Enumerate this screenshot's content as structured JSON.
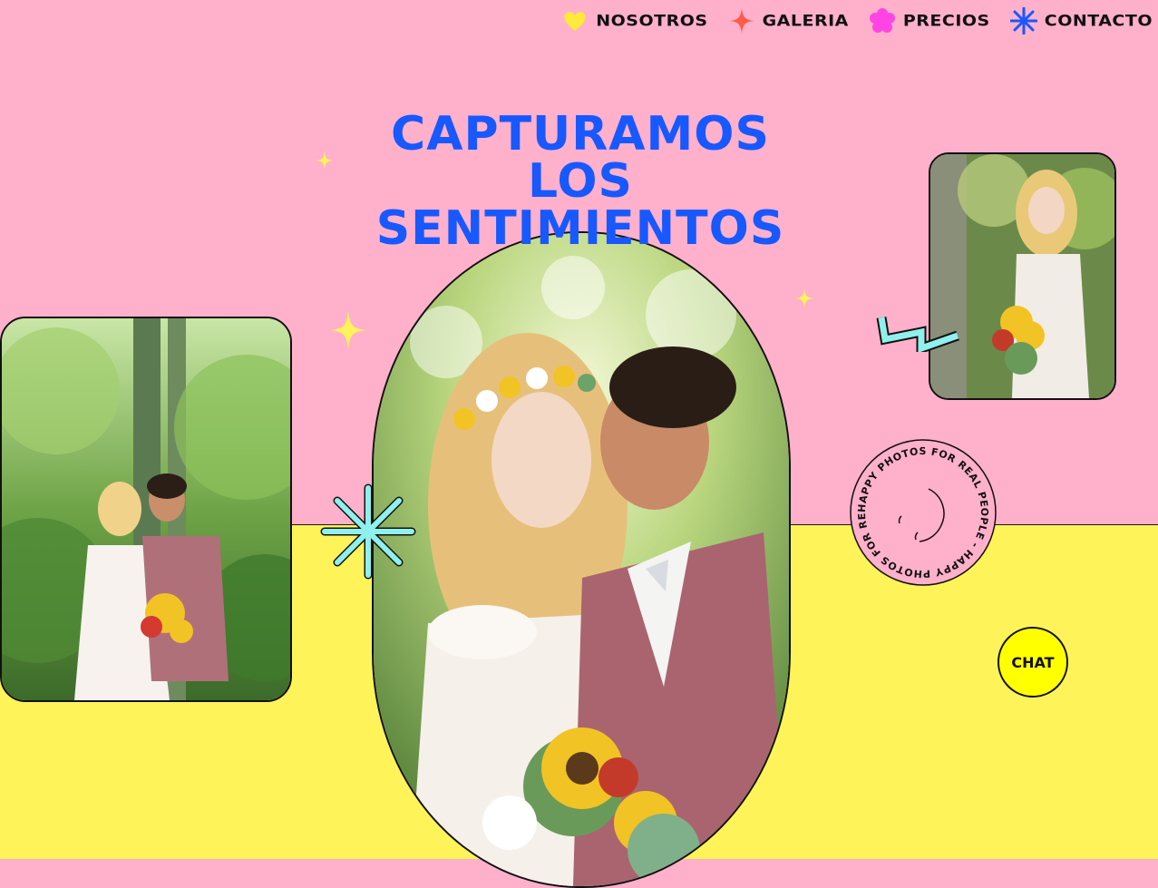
{
  "nav": {
    "items": [
      {
        "label": "NOSOTROS",
        "icon": "heart-icon",
        "color": "#ffe93a"
      },
      {
        "label": "GALERIA",
        "icon": "four-point-star-icon",
        "color": "#ff5a4a"
      },
      {
        "label": "PRECIOS",
        "icon": "flower-icon",
        "color": "#ff44e6"
      },
      {
        "label": "CONTACTO",
        "icon": "asterisk-icon",
        "color": "#1758ff"
      }
    ]
  },
  "hero": {
    "title_lines": [
      "CAPTURAMOS",
      "LOS",
      "SENTIMIENTOS"
    ]
  },
  "badge": {
    "text": "HAPPY PHOTOS FOR REAL PEOPLE - HAPPY PHOTOS FOR REAL PEOPLE - "
  },
  "chat": {
    "label": "CHAT"
  },
  "colors": {
    "background_pink": "#ffb0cb",
    "background_yellow": "#fff35a",
    "title_blue": "#1758ff",
    "accent_cyan": "#8ff0ec",
    "sparkle_yellow": "#fff35a",
    "chat_yellow": "#ffff00"
  }
}
